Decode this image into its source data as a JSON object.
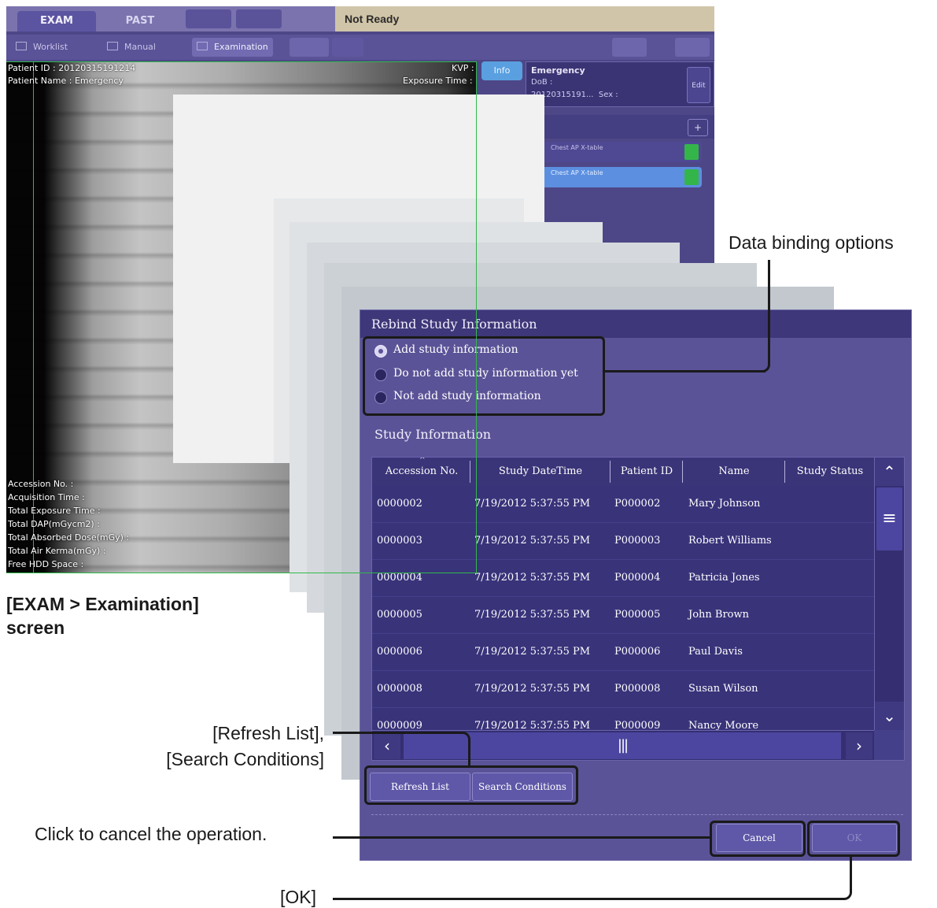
{
  "app": {
    "tabs": [
      "EXAM",
      "PAST"
    ],
    "status": "Not Ready",
    "nav": {
      "worklist": "Worklist",
      "manual": "Manual",
      "examination": "Examination"
    },
    "info_button": "Info",
    "patient": {
      "name": "Emergency",
      "dob_label": "DoB :",
      "id_prefix": "20120315191...",
      "sex_label": "Sex :"
    },
    "edit_button": "Edit",
    "exposures": [
      "Chest AP X-table",
      "Chest AP X-table"
    ],
    "xray_overlay_left": [
      "Patient ID : 20120315191214",
      "Patient Name : Emergency"
    ],
    "xray_overlay_right": [
      "KVP :",
      "Exposure Time :"
    ],
    "xray_overlay_bottom": [
      "Accession No. :",
      "Acquisition Time :",
      "Total Exposure Time :",
      "Total DAP(mGycm2) :",
      "Total Absorbed Dose(mGy) :",
      "Total Air Kerma(mGy) :",
      "Free HDD Space :"
    ]
  },
  "dialog": {
    "title": "Rebind Study Information",
    "radio_options": [
      "Add study information",
      "Do not add study information yet",
      "Not add study information"
    ],
    "selected_option": 0,
    "section_label": "Study Information",
    "columns": [
      "Accession No.",
      "Study DateTime",
      "Patient ID",
      "Name",
      "Study Status"
    ],
    "rows": [
      {
        "accession": "0000002",
        "datetime": "7/19/2012 5:37:55 PM",
        "patient_id": "P000002",
        "name": "Mary Johnson"
      },
      {
        "accession": "0000003",
        "datetime": "7/19/2012 5:37:55 PM",
        "patient_id": "P000003",
        "name": "Robert Williams"
      },
      {
        "accession": "0000004",
        "datetime": "7/19/2012 5:37:55 PM",
        "patient_id": "P000004",
        "name": "Patricia Jones"
      },
      {
        "accession": "0000005",
        "datetime": "7/19/2012 5:37:55 PM",
        "patient_id": "P000005",
        "name": "John Brown"
      },
      {
        "accession": "0000006",
        "datetime": "7/19/2012 5:37:55 PM",
        "patient_id": "P000006",
        "name": "Paul Davis"
      },
      {
        "accession": "0000008",
        "datetime": "7/19/2012 5:37:55 PM",
        "patient_id": "P000008",
        "name": "Susan Wilson"
      },
      {
        "accession": "0000009",
        "datetime": "7/19/2012 5:37:55 PM",
        "patient_id": "P000009",
        "name": "Nancy Moore"
      }
    ],
    "refresh_button": "Refresh List",
    "search_button": "Search Conditions",
    "cancel_button": "Cancel",
    "ok_button": "OK"
  },
  "annotations": {
    "screen_caption_line1": "[EXAM > Examination]",
    "screen_caption_line2": "screen",
    "data_binding": "Data binding options",
    "refresh_search_line1": "[Refresh List],",
    "refresh_search_line2": "[Search Conditions]",
    "cancel_note": "Click to cancel the operation.",
    "ok_note": "[OK]"
  },
  "colors": {
    "app_bg": "#4e4787",
    "dialog_bg": "#5a5397",
    "dialog_title_bg": "#3e3779",
    "row_bg": "#39337a",
    "status_bg": "#d0c5a8",
    "marker_green": "#31b84a",
    "callout": "#1a1a1a"
  }
}
